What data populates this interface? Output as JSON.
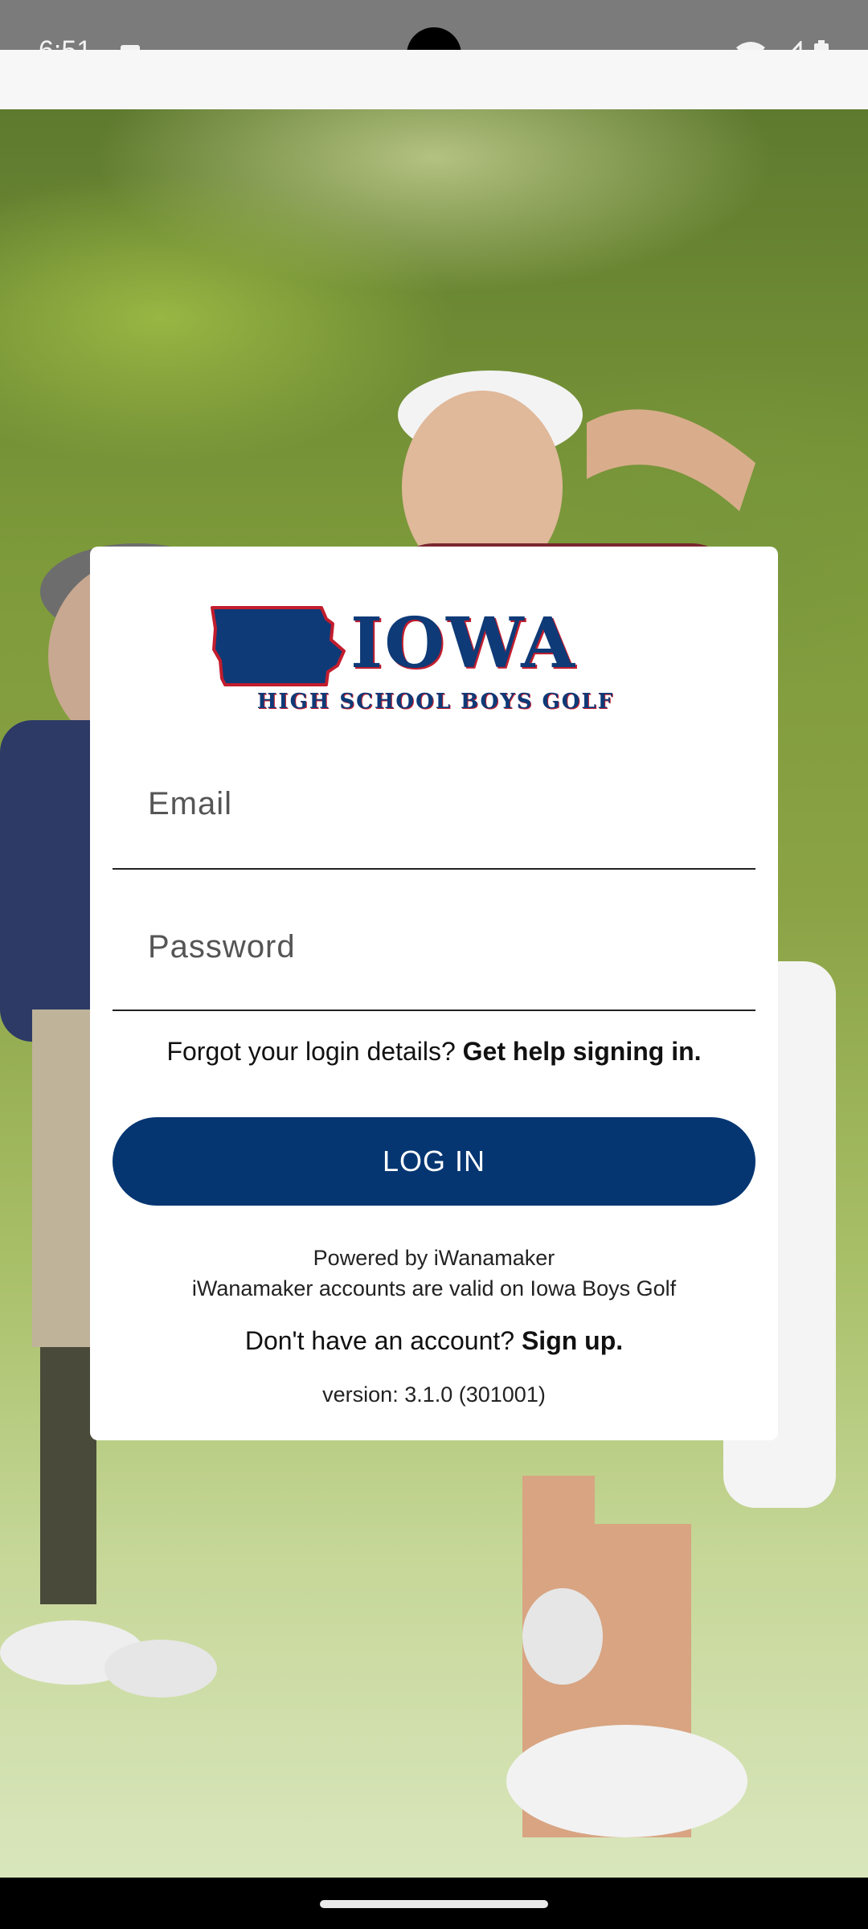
{
  "status_bar": {
    "time": "6:51",
    "icons": [
      "notification-icon",
      "wifi-icon",
      "signal-icon",
      "battery-icon"
    ]
  },
  "logo": {
    "wordmark": "IOWA",
    "subtitle": "HIGH SCHOOL BOYS GOLF",
    "colors": {
      "navy": "#0e3a77",
      "red": "#c21d2e"
    }
  },
  "login": {
    "email_placeholder": "Email",
    "password_placeholder": "Password",
    "forgot_prefix": "Forgot your login details? ",
    "forgot_link": "Get help signing in.",
    "login_button": "LOG IN",
    "powered_by": "Powered by iWanamaker",
    "accounts_note": "iWanamaker accounts are valid on Iowa Boys Golf",
    "signup_prefix": "Don't have an account? ",
    "signup_link": "Sign up.",
    "version": "version: 3.1.0 (301001)"
  },
  "colors": {
    "button": "#053672",
    "card": "#ffffff"
  }
}
